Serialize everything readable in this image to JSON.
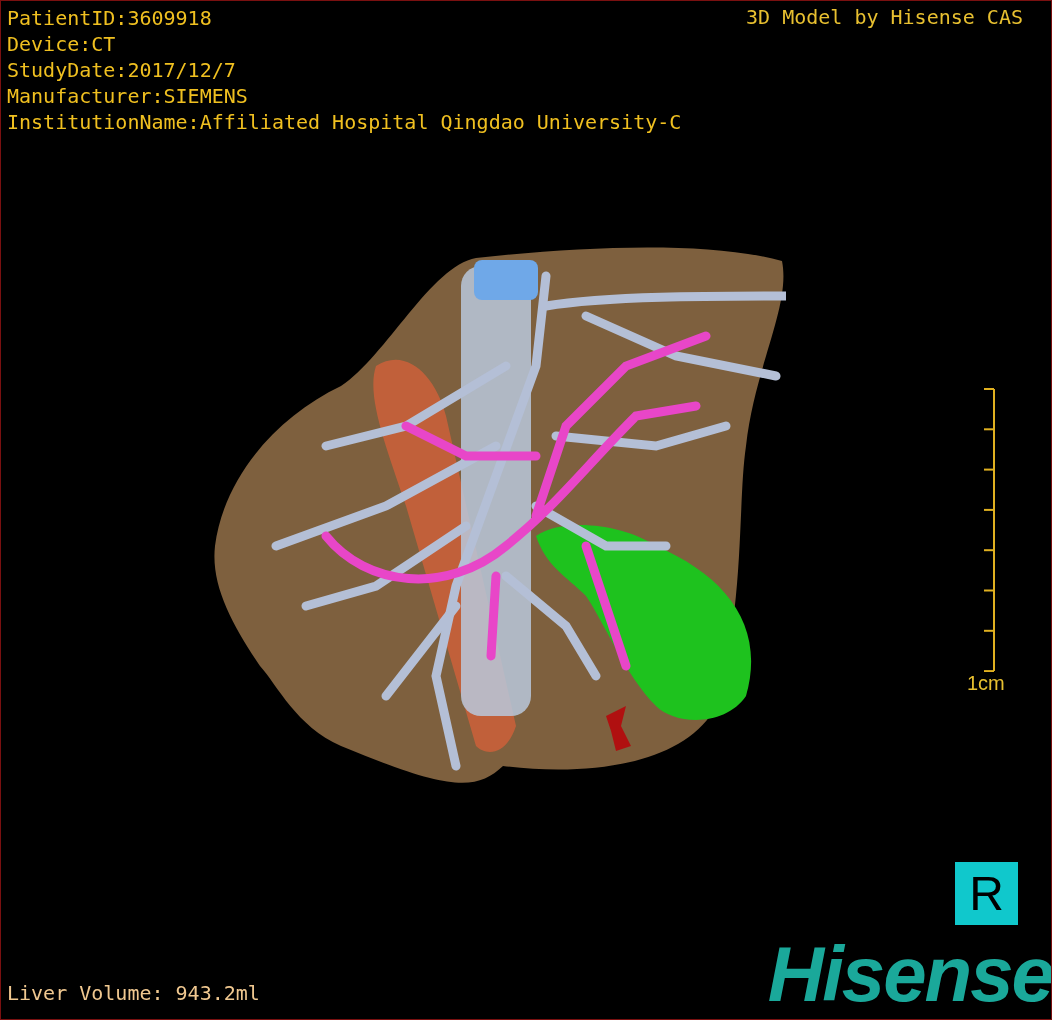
{
  "info_lines": [
    "PatientID:3609918",
    "Device:CT",
    "StudyDate:2017/12/7",
    "Manufacturer:SIEMENS",
    "InstitutionName:Affiliated Hospital Qingdao University-C"
  ],
  "title": "3D Model by Hisense CAS",
  "scale_bar": {
    "label": "1cm"
  },
  "orientation_marker": "R",
  "volume_text": "Liver Volume:  943.2ml",
  "logo": "Hisense"
}
